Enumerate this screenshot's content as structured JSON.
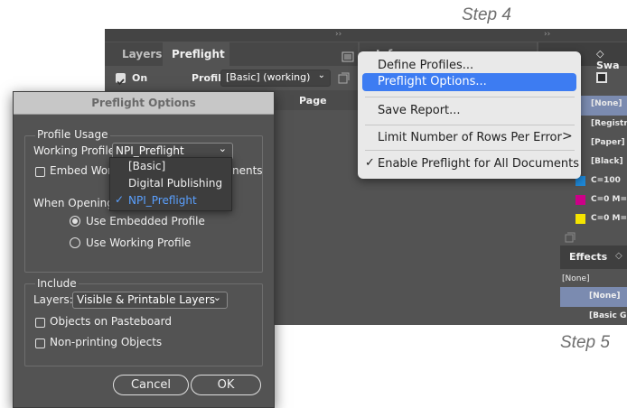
{
  "steps": {
    "step4": "Step 4",
    "step5": "Step 5"
  },
  "panel": {
    "tabs": [
      {
        "label": "Layers"
      },
      {
        "label": "Preflight"
      }
    ],
    "on_label": "On",
    "profile_label": "Profile:",
    "profile_value": "[Basic] (working)",
    "page_col": "Page",
    "info_tab": "Info"
  },
  "menu": {
    "items": [
      {
        "label": "Define Profiles..."
      },
      {
        "label": "Preflight Options..."
      },
      {
        "label": "Save Report..."
      },
      {
        "label": "Limit Number of Rows Per Error",
        "submenu_glyph": ">"
      },
      {
        "label": "Enable Preflight for All Documents",
        "check_glyph": "✓"
      }
    ],
    "highlight_color": "#3d7cf2"
  },
  "swatches": {
    "tab_label": "Swa",
    "rows": [
      {
        "label": "[None]",
        "color": "#ffffff"
      },
      {
        "label": "[Registr",
        "color": "#000000"
      },
      {
        "label": "[Paper]",
        "color": "#ffffff"
      },
      {
        "label": "[Black]",
        "color": "#000000"
      },
      {
        "label": "C=100",
        "color": "#1e88d8"
      },
      {
        "label": "C=0 M=",
        "color": "#cc0088"
      },
      {
        "label": "C=0 M=",
        "color": "#f4e400"
      }
    ]
  },
  "effects": {
    "tab_label": "Effects",
    "none_top": "[None]",
    "rows": [
      {
        "label": "[None]"
      },
      {
        "label": "[Basic G"
      }
    ]
  },
  "dialog": {
    "title": "Preflight Options",
    "profile_usage": {
      "heading": "Profile Usage",
      "working_profile_label": "Working Profile:",
      "working_profile_value": "NPI_Preflight",
      "embed_label_left": "Embed Workin",
      "embed_label_right": "nents",
      "when_opening_label": "When Opening D",
      "options": [
        {
          "label": "Use Embedded Profile",
          "selected": true
        },
        {
          "label": "Use Working Profile",
          "selected": false
        }
      ],
      "dropdown_options": [
        {
          "label": "[Basic]"
        },
        {
          "label": "Digital Publishing"
        },
        {
          "label": "NPI_Preflight",
          "check_glyph": "✓"
        }
      ]
    },
    "include": {
      "heading": "Include",
      "layers_label": "Layers:",
      "layers_value": "Visible & Printable Layers",
      "checkboxes": [
        {
          "label": "Objects on Pasteboard"
        },
        {
          "label": "Non-printing Objects"
        }
      ]
    },
    "buttons": {
      "cancel": "Cancel",
      "ok": "OK"
    }
  }
}
